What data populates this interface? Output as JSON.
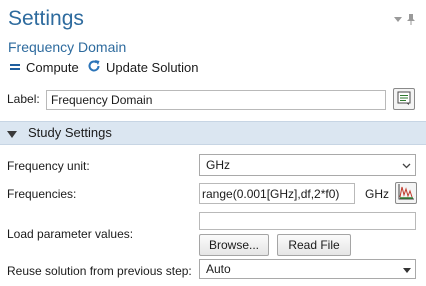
{
  "header": {
    "title": "Settings",
    "subtitle": "Frequency Domain",
    "icons": [
      "dropdown-arrow-icon",
      "pin-icon"
    ]
  },
  "toolbar": {
    "compute_label": "Compute",
    "compute_icon": "equals-icon",
    "update_label": "Update Solution",
    "update_icon": "refresh-icon"
  },
  "label_row": {
    "label": "Label:",
    "value": "Frequency Domain",
    "button_icon": "document-comment-icon"
  },
  "section": {
    "title": "Study Settings",
    "expanded": true
  },
  "study_settings": {
    "frequency_unit": {
      "label": "Frequency unit:",
      "value": "GHz"
    },
    "frequencies": {
      "label": "Frequencies:",
      "value": "range(0.001[GHz],df,2*f0)",
      "unit": "GHz",
      "button_icon": "range-chart-icon"
    },
    "load_parameter_values": {
      "label": "Load parameter values:",
      "value": "",
      "browse_label": "Browse...",
      "read_file_label": "Read File"
    },
    "reuse_solution": {
      "label": "Reuse solution from previous step:",
      "value": "Auto"
    }
  },
  "colors": {
    "title_blue": "#2e6b9e",
    "section_bg": "#dbe6f1",
    "compute_icon": "#1f5f9e",
    "refresh_icon": "#2b74b8"
  }
}
